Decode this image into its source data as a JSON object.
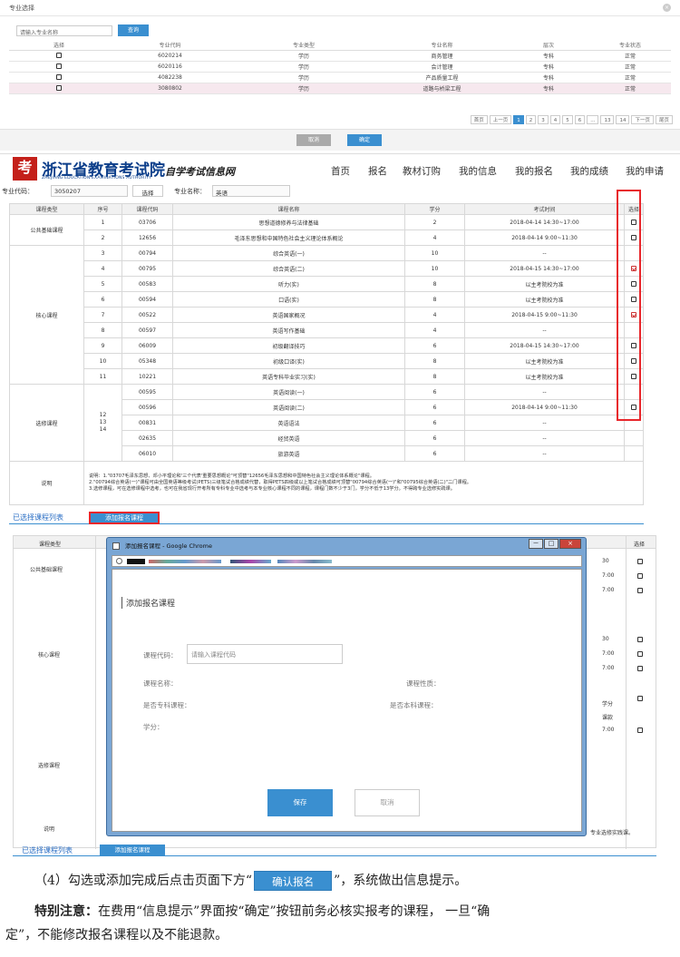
{
  "panel1": {
    "title": "专业选择",
    "close_icon": "×",
    "search": {
      "placeholder": "请输入专业名称",
      "button": "查询"
    },
    "columns": [
      "选择",
      "专业代码",
      "专业类型",
      "专业名称",
      "层次",
      "专业状态"
    ],
    "rows": [
      {
        "code": "6020214",
        "type": "学历",
        "name": "商务管理",
        "level": "专科",
        "status": "正常"
      },
      {
        "code": "6020116",
        "type": "学历",
        "name": "会计管理",
        "level": "专科",
        "status": "正常"
      },
      {
        "code": "4082238",
        "type": "学历",
        "name": "产品质量工程",
        "level": "专科",
        "status": "正常"
      },
      {
        "code": "3080802",
        "type": "学历",
        "name": "道路与桥梁工程",
        "level": "专科",
        "status": "正常"
      }
    ],
    "pager": [
      "首页",
      "上一页",
      "1",
      "2",
      "3",
      "4",
      "5",
      "6",
      "...",
      "13",
      "14",
      "下一页",
      "尾页"
    ],
    "cancel": "取消",
    "ok": "确定"
  },
  "panel2": {
    "logo_mark": "考",
    "logo_cn": "浙江省教育考试院",
    "logo_en": "ZHEJIANG EDUCATION EXAMINATIONS AUTHORITY",
    "logo_sub": "自学考试信息网",
    "nav": [
      "首页",
      "报名",
      "教材订购",
      "我的信息",
      "我的报名",
      "我的成绩",
      "我的申请"
    ],
    "major_code_label": "专业代码：",
    "major_code": "3050207",
    "select_button": "选择",
    "major_name_label": "专业名称：",
    "major_name": "英语",
    "columns": [
      "课程类型",
      "序号",
      "课程代码",
      "课程名称",
      "学分",
      "考试时间",
      "选择"
    ],
    "groups": {
      "public": "公共基础课程",
      "core": "核心课程",
      "elective": "选修课程",
      "elective_seq": "12\n13\n14"
    },
    "rows": [
      {
        "seq": "1",
        "code": "03706",
        "name": "思想道德修养与法律基础",
        "credit": "2",
        "time": "2018-04-14 14:30~17:00",
        "check": "off"
      },
      {
        "seq": "2",
        "code": "12656",
        "name": "毛泽东思想和中国特色社会主义理论体系概论",
        "credit": "4",
        "time": "2018-04-14 9:00~11:30",
        "check": "off"
      },
      {
        "seq": "3",
        "code": "00794",
        "name": "综合英语(一)",
        "credit": "10",
        "time": "--",
        "check": "none"
      },
      {
        "seq": "4",
        "code": "00795",
        "name": "综合英语(二)",
        "credit": "10",
        "time": "2018-04-15 14:30~17:00",
        "check": "on"
      },
      {
        "seq": "5",
        "code": "00583",
        "name": "听力(实)",
        "credit": "8",
        "time": "以主考院校为准",
        "check": "off"
      },
      {
        "seq": "6",
        "code": "00594",
        "name": "口语(实)",
        "credit": "8",
        "time": "以主考院校为准",
        "check": "off"
      },
      {
        "seq": "7",
        "code": "00522",
        "name": "英语国家概况",
        "credit": "4",
        "time": "2018-04-15 9:00~11:30",
        "check": "on"
      },
      {
        "seq": "8",
        "code": "00597",
        "name": "英语写作基础",
        "credit": "4",
        "time": "--",
        "check": "none"
      },
      {
        "seq": "9",
        "code": "06009",
        "name": "初级翻译技巧",
        "credit": "6",
        "time": "2018-04-15 14:30~17:00",
        "check": "off"
      },
      {
        "seq": "10",
        "code": "05348",
        "name": "初级口译(实)",
        "credit": "8",
        "time": "以主考院校为准",
        "check": "off"
      },
      {
        "seq": "11",
        "code": "10221",
        "name": "英语专科毕业实习(实)",
        "credit": "8",
        "time": "以主考院校为准",
        "check": "off"
      },
      {
        "seq": "",
        "code": "00595",
        "name": "英语阅读(一)",
        "credit": "6",
        "time": "--",
        "check": "none"
      },
      {
        "seq": "",
        "code": "00596",
        "name": "英语阅读(二)",
        "credit": "6",
        "time": "2018-04-14 9:00~11:30",
        "check": "off"
      },
      {
        "seq": "",
        "code": "00831",
        "name": "英语语法",
        "credit": "6",
        "time": "--",
        "check": "none"
      },
      {
        "seq": "",
        "code": "02635",
        "name": "经贸英语",
        "credit": "6",
        "time": "--",
        "check": "none"
      },
      {
        "seq": "",
        "code": "06010",
        "name": "旅游英语",
        "credit": "6",
        "time": "--",
        "check": "none"
      }
    ],
    "note_label": "说明",
    "note_lines": [
      "说明：1.\"03707毛泽东思想、邓小平理论和'三个代表'重要思想概论\"可顶替\"12656毛泽东思想和中国特色社会主义理论体系概论\"课程。",
      "2.\"00794综合英语(一)\"课程可由全国英语等级考试(PETS)三级笔试合格成绩代替，取得PETS四级或以上笔试合格成绩可顶替\"00794综合英语(一)\"和\"00795综合英语(二)\"二门课程。",
      "3.选修课程，可在选修课程中选考，也可在我省现行开考所有专科专业中选考与本专业核心课程不同的课程，课程门数不少于3门，学分不低于13学分。不得跨专业选修实践课。"
    ],
    "selected_list_label": "已选择课程列表",
    "add_course_button": "添加报名课程"
  },
  "panel3": {
    "bg_col_type": "课程类型",
    "bg_col_select": "选择",
    "bg_groups": {
      "public": "公共基础课程",
      "core": "核心课程",
      "elective": "选修课程",
      "note": "说明"
    },
    "bg_right_frag": [
      "30",
      "7:00",
      "7:00",
      "30",
      "7:00",
      "7:00",
      "7:00",
      "学分",
      "课款"
    ],
    "bg_note_tail": "专业选修实践课。",
    "window_title": "添加报名课程 - Google Chrome",
    "window_buttons": [
      "－",
      "□",
      "×"
    ],
    "dialog_title": "添加报名课程",
    "course_code_label": "课程代码：",
    "course_code_placeholder": "请输入课程代码",
    "course_name_label": "课程名称：",
    "course_type_label": "课程性质：",
    "is_zhuanke_label": "是否专科课程：",
    "is_benke_label": "是否本科课程：",
    "credit_label": "学分：",
    "save": "保存",
    "cancel": "取消",
    "selected_list_label": "已选择课程列表",
    "add_course_button": "添加报名课程"
  },
  "text": {
    "step_prefix": "（4）勾选或添加完成后点击页面下方“",
    "confirm_button": "确认报名",
    "step_suffix": "”，系统做出信息提示。",
    "notice_bold": "特别注意：",
    "notice_line1": "在费用“信息提示”界面按“确定”按钮前务必核实报考的课程， 一旦“确",
    "notice_line2": "定”，不能修改报名课程以及不能退款。"
  },
  "colors": {
    "accent": "#3a8fd0",
    "highlight": "#e8262b",
    "brand": "#0c3e8a"
  }
}
